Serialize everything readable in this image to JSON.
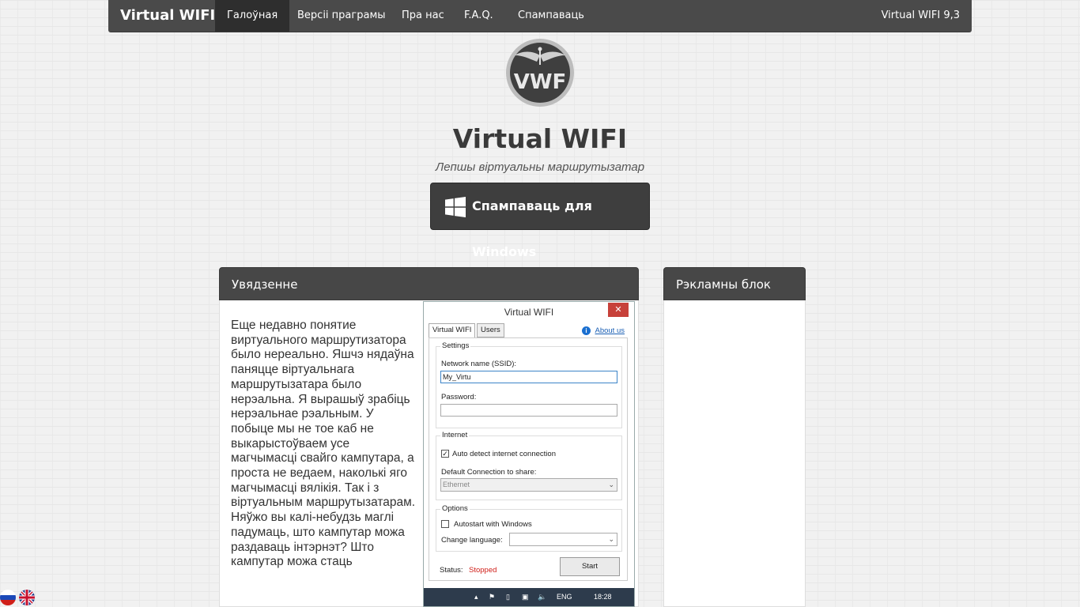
{
  "nav": {
    "brand": "Virtual WIFI",
    "items": [
      "Галоўная",
      "Версіі праграмы",
      "Пра нас",
      "F.A.Q.",
      "Спампаваць"
    ],
    "version": "Virtual WIFI 9,3"
  },
  "hero": {
    "logo_text": "VWF",
    "title": "Virtual WIFI",
    "subtitle": "Лепшы віртуальны маршрутызатар",
    "download_label": "Спампаваць для Windows"
  },
  "intro": {
    "heading": "Увядзенне",
    "text": "Еще недавно понятие виртуального маршрутизатора было нереально. Яшчэ нядаўна паняцце віртуальнага маршрутызатара было нерэальна. Я вырашыў зрабіць нерэальнае рэальным. У побыце мы не тое каб не выкарыстоўваем усе магчымасці свайго кампутара, а проста не ведаем, наколькі яго магчымасці вялікія. Так і з віртуальным маршрутызатарам. Няўжо вы калі-небудзь маглі падумаць, што кампутар можа раздаваць інтэрнэт? Што кампутар можа стаць"
  },
  "ads": {
    "heading": "Рэкламны блок"
  },
  "app": {
    "title": "Virtual WIFI",
    "close": "✕",
    "tabs": [
      "Virtual WIFI",
      "Users"
    ],
    "about": "About us",
    "settings_label": "Settings",
    "ssid_label": "Network name (SSID):",
    "ssid_value": "My_Virtu",
    "password_label": "Password:",
    "password_value": "",
    "internet_label": "Internet",
    "auto_detect_label": "Auto detect internet connection",
    "default_conn_label": "Default Connection to share:",
    "default_conn_value": "Ethernet",
    "options_label": "Options",
    "autostart_label": "Autostart with Windows",
    "language_label": "Change language:",
    "language_value": "",
    "status_label": "Status:",
    "status_value": "Stopped",
    "start_label": "Start",
    "taskbar_lang": "ENG",
    "taskbar_time": "18:28"
  }
}
